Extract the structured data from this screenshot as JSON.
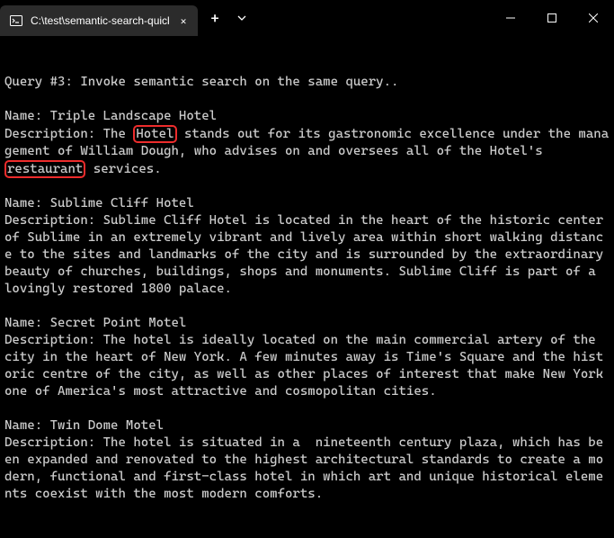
{
  "titlebar": {
    "tab_title": "C:\\test\\semantic-search-quick",
    "tab_icon_name": "terminal-icon",
    "close_symbol": "✕",
    "new_tab_symbol": "+",
    "dropdown_name": "chevron-down-icon"
  },
  "window_controls": {
    "minimize_name": "minimize-icon",
    "maximize_name": "maximize-icon",
    "close_name": "close-icon"
  },
  "terminal": {
    "blank1": "",
    "blank2": "",
    "query_line": "Query #3: Invoke semantic search on the same query..",
    "blank3": "",
    "r1_name": "Name: Triple Landscape Hotel",
    "r1_desc_pre": "Description: The ",
    "r1_hl1": "Hotel",
    "r1_desc_mid": " stands out for its gastronomic excellence under the management of William Dough, who advises on and oversees all of the Hotel's ",
    "r1_hl2": "restaurant",
    "r1_desc_post": " services.",
    "blank4": "",
    "r2_name": "Name: Sublime Cliff Hotel",
    "r2_desc": "Description: Sublime Cliff Hotel is located in the heart of the historic center of Sublime in an extremely vibrant and lively area within short walking distance to the sites and landmarks of the city and is surrounded by the extraordinary beauty of churches, buildings, shops and monuments. Sublime Cliff is part of a lovingly restored 1800 palace.",
    "blank5": "",
    "r3_name": "Name: Secret Point Motel",
    "r3_desc": "Description: The hotel is ideally located on the main commercial artery of the city in the heart of New York. A few minutes away is Time's Square and the historic centre of the city, as well as other places of interest that make New York one of America's most attractive and cosmopolitan cities.",
    "blank6": "",
    "r4_name": "Name: Twin Dome Motel",
    "r4_desc": "Description: The hotel is situated in a  nineteenth century plaza, which has been expanded and renovated to the highest architectural standards to create a modern, functional and first-class hotel in which art and unique historical elements coexist with the most modern comforts."
  },
  "highlights": [
    {
      "text": "Hotel",
      "context": "result 1 description"
    },
    {
      "text": "restaurant",
      "context": "result 1 description"
    }
  ]
}
